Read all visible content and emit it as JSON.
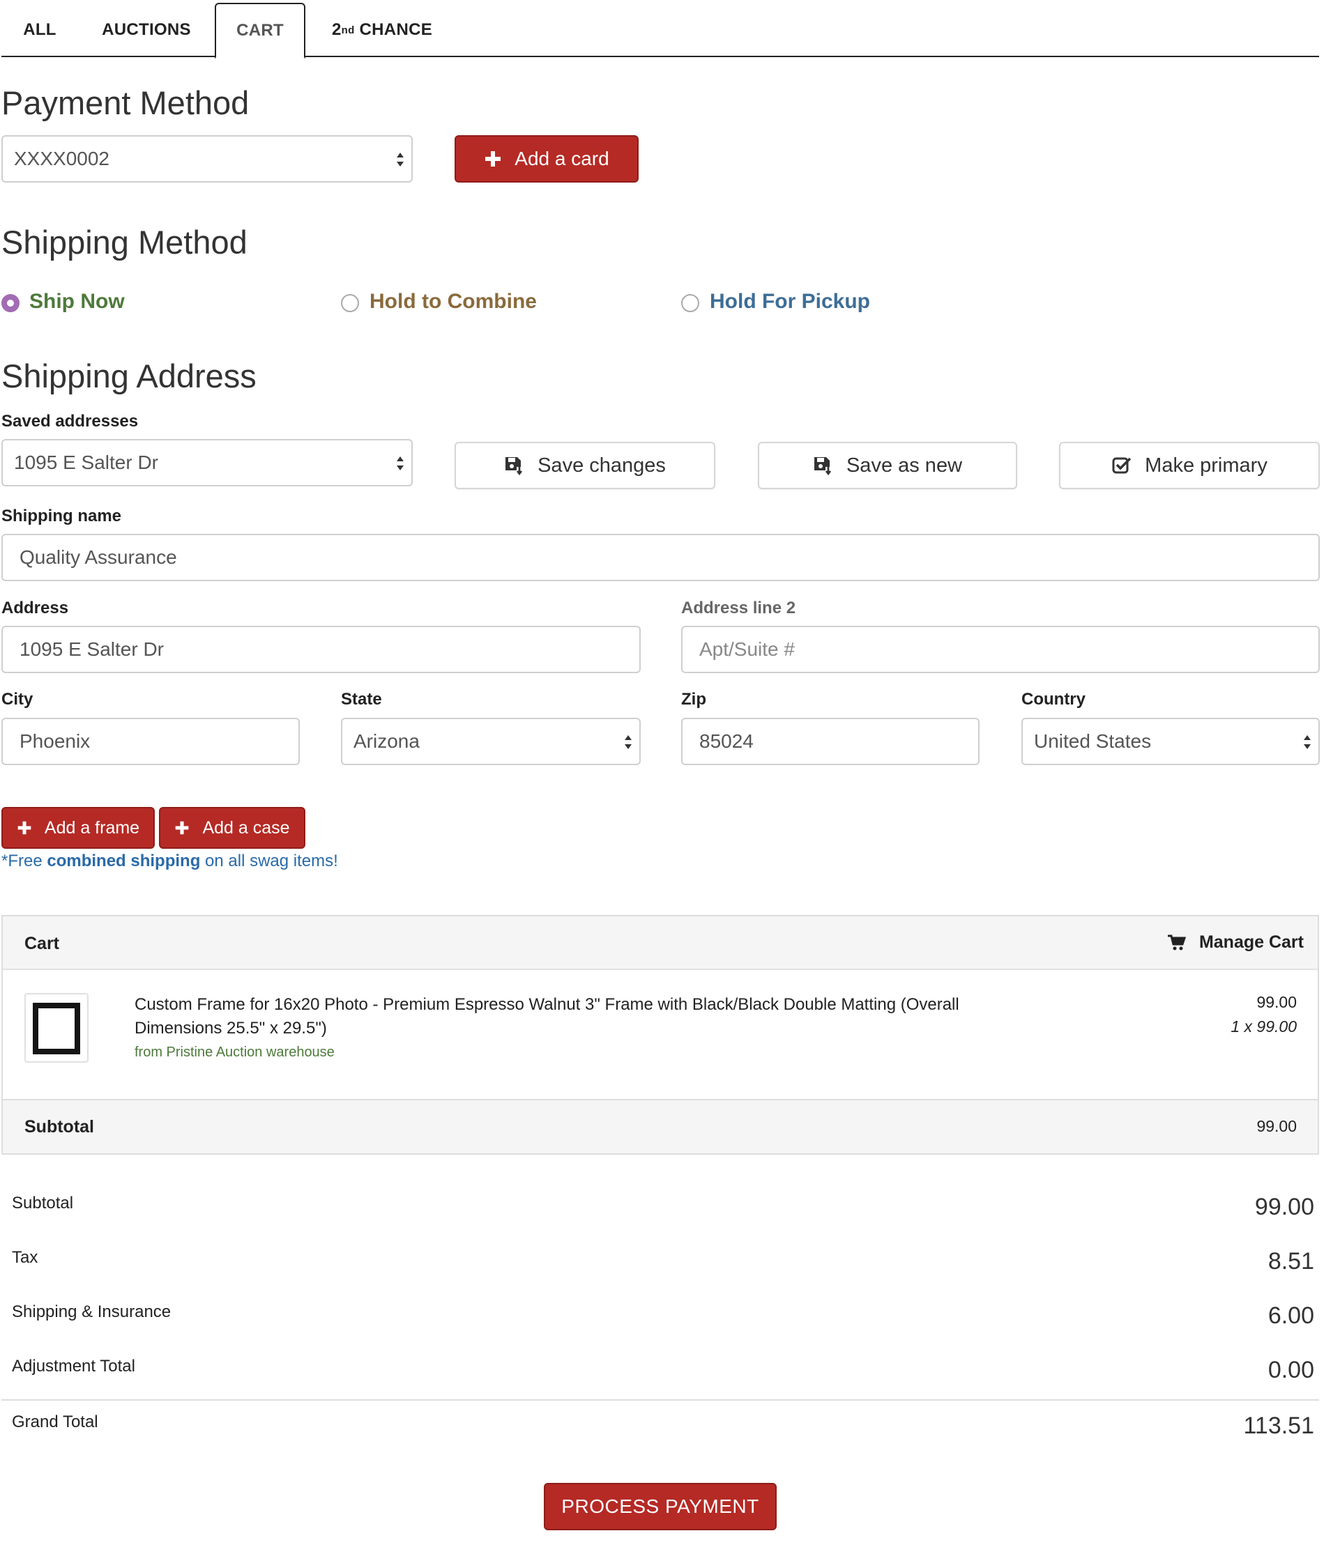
{
  "tabs": {
    "all": "ALL",
    "auctions": "AUCTIONS",
    "cart": "CART",
    "second_chance_num": "2",
    "second_chance_sup": "nd",
    "second_chance_word": "CHANCE"
  },
  "payment": {
    "heading": "Payment Method",
    "selected_card": "XXXX0002",
    "add_card_label": "Add a card"
  },
  "shipping_method": {
    "heading": "Shipping Method",
    "options": [
      {
        "label": "Ship Now",
        "color": "#4d7a3a",
        "checked": true
      },
      {
        "label": "Hold to Combine",
        "color": "#8a6a3c",
        "checked": false
      },
      {
        "label": "Hold For Pickup",
        "color": "#3d6e96",
        "checked": false
      }
    ]
  },
  "address": {
    "heading": "Shipping Address",
    "saved_label": "Saved addresses",
    "saved_value": "1095 E Salter Dr",
    "save_changes": "Save changes",
    "save_as_new": "Save as new",
    "make_primary": "Make primary",
    "name_label": "Shipping name",
    "name_value": "Quality Assurance",
    "address_label": "Address",
    "address_value": "1095 E Salter Dr",
    "address2_label": "Address line 2",
    "address2_placeholder": "Apt/Suite #",
    "city_label": "City",
    "city_value": "Phoenix",
    "state_label": "State",
    "state_value": "Arizona",
    "zip_label": "Zip",
    "zip_value": "85024",
    "country_label": "Country",
    "country_value": "United States"
  },
  "addons": {
    "add_frame": "Add a frame",
    "add_case": "Add a case",
    "note_prefix": "*Free ",
    "note_bold": "combined shipping",
    "note_suffix": " on all swag items!"
  },
  "cart": {
    "title": "Cart",
    "manage": "Manage Cart",
    "item": {
      "desc_line1": "Custom Frame for 16x20 Photo - Premium Espresso Walnut 3\" Frame with Black/Black Double Matting (Overall",
      "desc_line2": "Dimensions 25.5\" x 29.5\")",
      "source": "from Pristine Auction warehouse",
      "price": "99.00",
      "qty_price": "1 x 99.00"
    },
    "subtotal_label": "Subtotal",
    "subtotal_value": "99.00"
  },
  "summary": {
    "subtotal_label": "Subtotal",
    "subtotal_value": "99.00",
    "tax_label": "Tax",
    "tax_value": "8.51",
    "shipping_label": "Shipping & Insurance",
    "shipping_value": "6.00",
    "adjustment_label": "Adjustment Total",
    "adjustment_value": "0.00",
    "grand_label": "Grand Total",
    "grand_value": "113.51"
  },
  "process_button": "PROCESS PAYMENT",
  "colors": {
    "brand_red": "#b52a25",
    "link_blue": "#2a6aa8",
    "source_green": "#4d7a3a"
  }
}
